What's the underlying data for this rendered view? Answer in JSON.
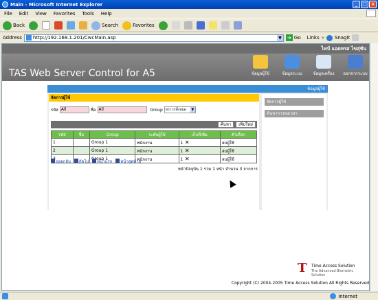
{
  "window": {
    "title": "Main - Microsoft Internet Explorer"
  },
  "menu": [
    "File",
    "Edit",
    "View",
    "Favorites",
    "Tools",
    "Help"
  ],
  "toolbar": {
    "back": "Back",
    "search": "Search",
    "favorites": "Favorites"
  },
  "address": {
    "label": "Address",
    "url": "http://192.168.1.201/CwcMain.asp",
    "go": "Go",
    "links": "Links",
    "snagit": "SnagIt"
  },
  "app": {
    "user": "ไทป์ แอดทรส ไขสุ่ชัน",
    "title": "TAS Web Server Control for A5",
    "nav": [
      {
        "label": "ข้อมูลผู้ใช้"
      },
      {
        "label": "ข้อมูลระบบ"
      },
      {
        "label": "ข้อมูลเครื่อง"
      },
      {
        "label": "ออกจากระบบ"
      }
    ],
    "section": "ข้อมูลผู้ใช้"
  },
  "panel": {
    "title": "จัดการผู้ใช้",
    "code_label": "รหัส",
    "code_value": "All",
    "name_label": "ชื่อ",
    "name_value": "All",
    "group_label": "Group",
    "group_value": "ทราวกทั้งหมด",
    "search_button": "ค้นหา",
    "add_button": "เพิ่มใหม่"
  },
  "table": {
    "headers": [
      "รหัส",
      "ชื่อ",
      "Group",
      "ระดับผู้ใช้",
      "เก็บที่เพิ่ม",
      "ตัวเลือก"
    ],
    "rows": [
      {
        "id": "1",
        "name": "",
        "group": "Group 1",
        "level": "พนักงาน",
        "count": "1",
        "action": "ลบผู้ใช้"
      },
      {
        "id": "2",
        "name": "",
        "group": "Group 1",
        "level": "พนักงาน",
        "count": "1",
        "action": "ลบผู้ใช้"
      },
      {
        "id": "3",
        "name": "",
        "group": "Group 1",
        "level": "พนักงาน",
        "count": "1",
        "action": "ลบผู้ใช้"
      }
    ]
  },
  "pager": {
    "back": "ถอยกลับ",
    "next": "ถัดไป",
    "first": "หน้าแรก",
    "last": "หน้าสุดท้าย",
    "info": "หน้าปัจจุบัน 1   รวม 1 หน้า   จำนวน 3 จากการ"
  },
  "side": {
    "links": [
      "จัดการผู้ใช้",
      "ค้นหาการลงเวลา"
    ]
  },
  "footer": {
    "logo_name": "Time Access Solution",
    "logo_tag": "The Advanced Biometric Solution",
    "copyright": "Copyright (C) 2004-2005 Time Access Solution All Rights Reserved"
  },
  "status": {
    "zone": "Internet"
  }
}
